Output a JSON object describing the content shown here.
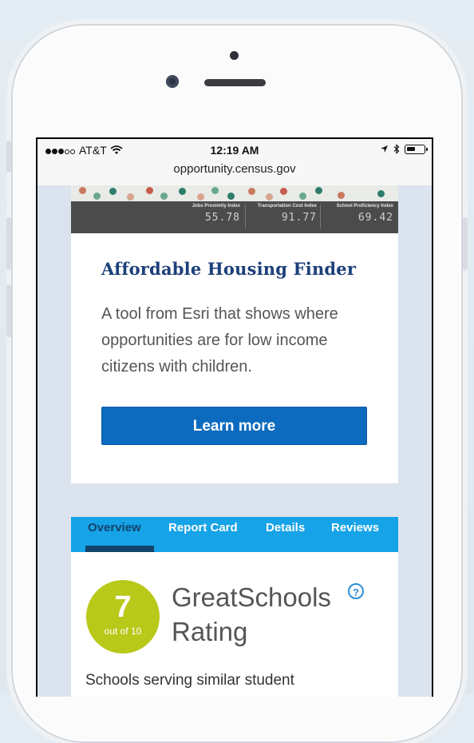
{
  "status_bar": {
    "carrier": "AT&T",
    "time": "12:19 AM",
    "url": "opportunity.census.gov"
  },
  "housing_card": {
    "stats": [
      {
        "label": "Jobs Proximity Index",
        "value": "55.78"
      },
      {
        "label": "Transportation Cost Index",
        "value": "91.77"
      },
      {
        "label": "School Proficiency Index",
        "value": "69.42"
      }
    ],
    "title": "Affordable Housing Finder",
    "description": "A tool from Esri that shows where opportunities are for low income citizens with children.",
    "button_label": "Learn more"
  },
  "school_card": {
    "tabs": [
      {
        "label": "Overview",
        "active": true
      },
      {
        "label": "Report Card",
        "active": false
      },
      {
        "label": "Details",
        "active": false
      },
      {
        "label": "Reviews",
        "active": false
      }
    ],
    "rating": {
      "value": "7",
      "out_of": "out of 10"
    },
    "rating_title": "GreatSchools Rating",
    "help_symbol": "?",
    "description": "Schools serving similar student"
  },
  "icons": [
    "signal-dots-icon",
    "wifi-icon",
    "location-arrow-icon",
    "bluetooth-icon",
    "battery-icon",
    "help-icon"
  ],
  "colors": {
    "link_blue": "#1b3f7a",
    "button_blue": "#0d6bbf",
    "tab_bar": "#16a3e8",
    "tab_active": "#13436b",
    "rating_badge": "#b8c91a",
    "page_bg": "#dbe3ef"
  }
}
